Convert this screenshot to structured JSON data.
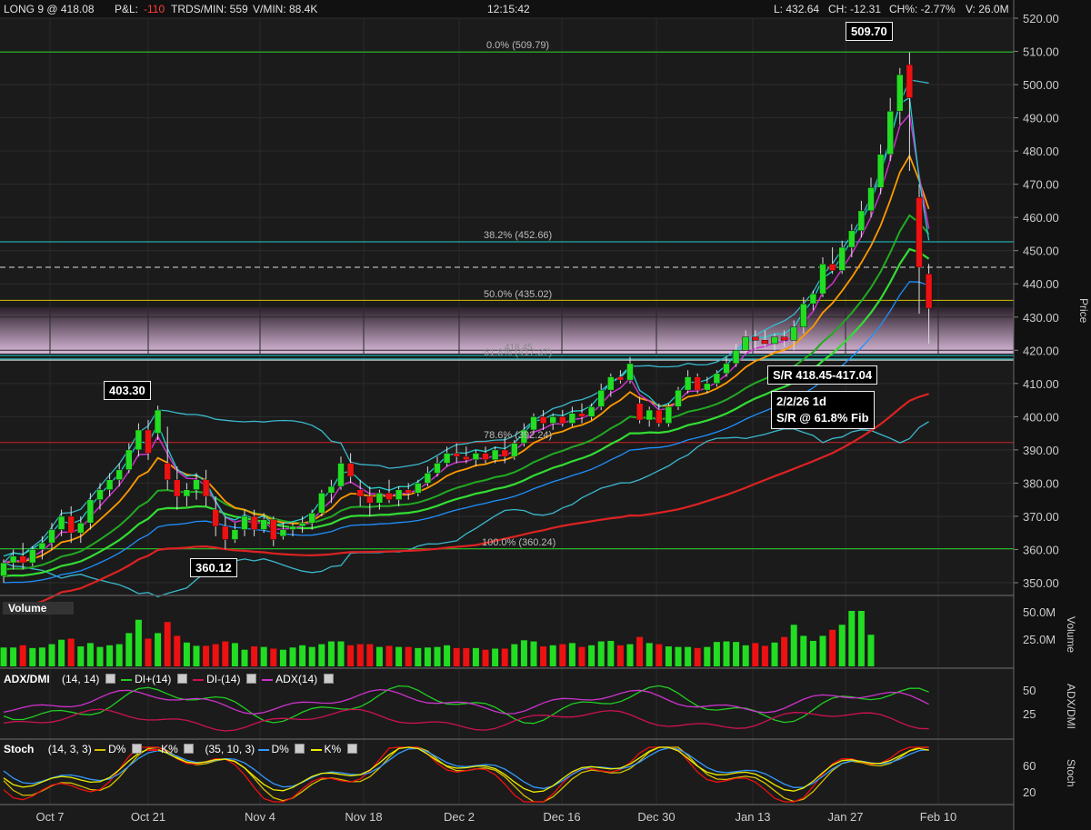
{
  "header": {
    "position": "LONG 9 @ 418.08",
    "pnl_label": "P&L:",
    "pnl_value": "-110",
    "trades_per_min": "TRDS/MIN: 559",
    "volume_per_min": "V/MIN: 88.4K",
    "clock": "12:15:42",
    "last": "L: 432.64",
    "change": "CH: -12.31",
    "change_pct": "CH%: -2.77%",
    "volume": "V: 26.0M"
  },
  "colors": {
    "up": "#22dd22",
    "down": "#ee1111",
    "background": "#1b1b1b",
    "fib_green": "#22cc22",
    "fib_cyan": "#22cccc",
    "fib_yellow": "#d4c000",
    "fib_red": "#cc2222"
  },
  "panels": {
    "volume_title": "Volume",
    "adx_title": "ADX/DMI",
    "adx_params": "(14, 14)",
    "adx_di_plus": "DI+(14)",
    "adx_di_minus": "DI-(14)",
    "adx_adx": "ADX(14)",
    "stoch_title": "Stoch",
    "stoch_params1": "(14, 3, 3)",
    "stoch_d1": "D%",
    "stoch_k1": "K%",
    "stoch_params2": "(35, 10, 3)",
    "stoch_d2": "D%",
    "stoch_k2": "K%"
  },
  "annotations": {
    "high_tag": "509.70",
    "peak_tag": "403.30",
    "low_tag": "360.12",
    "sr_tag": "S/R 418.45-417.04",
    "note_line1": "2/2/26 1d",
    "note_line2": "S/R @ 61.8% Fib",
    "fib_0": "0.0% (509.79)",
    "fib_382": "38.2% (452.66)",
    "fib_50": "50.0% (435.02)",
    "fib_618": "61.8% (417.37)",
    "fib_618_overlay": "418.45",
    "fib_786": "78.6% (392.24)",
    "fib_100": "100.0% (360.24)"
  },
  "chart_data": {
    "type": "candlestick",
    "ylabel": "Price",
    "ylim": [
      345,
      525
    ],
    "yticks": [
      "350.00",
      "360.00",
      "370.00",
      "380.00",
      "390.00",
      "400.00",
      "410.00",
      "420.00",
      "430.00",
      "440.00",
      "450.00",
      "460.00",
      "470.00",
      "480.00",
      "490.00",
      "500.00",
      "510.00",
      "520.00"
    ],
    "x_labels": [
      "Oct 7",
      "Oct 21",
      "Nov 4",
      "Nov 18",
      "Dec 2",
      "Dec 16",
      "Dec 30",
      "Jan 13",
      "Jan 27",
      "Feb 10"
    ],
    "fib_levels": [
      509.79,
      452.66,
      435.02,
      417.37,
      392.24,
      360.24
    ],
    "sr_zone": [
      417.04,
      418.45
    ],
    "current_price_line": 445,
    "candles": [
      {
        "o": 352,
        "h": 357,
        "l": 350,
        "c": 356
      },
      {
        "o": 356,
        "h": 360,
        "l": 354,
        "c": 358
      },
      {
        "o": 358,
        "h": 362,
        "l": 354,
        "c": 356
      },
      {
        "o": 356,
        "h": 361,
        "l": 355,
        "c": 360
      },
      {
        "o": 360,
        "h": 364,
        "l": 357,
        "c": 362
      },
      {
        "o": 362,
        "h": 368,
        "l": 360,
        "c": 366
      },
      {
        "o": 366,
        "h": 372,
        "l": 364,
        "c": 370
      },
      {
        "o": 370,
        "h": 373,
        "l": 362,
        "c": 365
      },
      {
        "o": 365,
        "h": 370,
        "l": 362,
        "c": 368
      },
      {
        "o": 368,
        "h": 377,
        "l": 366,
        "c": 375
      },
      {
        "o": 375,
        "h": 380,
        "l": 372,
        "c": 378
      },
      {
        "o": 378,
        "h": 383,
        "l": 376,
        "c": 381
      },
      {
        "o": 381,
        "h": 386,
        "l": 379,
        "c": 384
      },
      {
        "o": 384,
        "h": 392,
        "l": 383,
        "c": 390
      },
      {
        "o": 390,
        "h": 398,
        "l": 388,
        "c": 396
      },
      {
        "o": 396,
        "h": 399,
        "l": 387,
        "c": 389
      },
      {
        "o": 395,
        "h": 403.3,
        "l": 393,
        "c": 402
      },
      {
        "o": 386,
        "h": 397,
        "l": 378,
        "c": 381
      },
      {
        "o": 381,
        "h": 385,
        "l": 372,
        "c": 376
      },
      {
        "o": 376,
        "h": 380,
        "l": 373,
        "c": 378
      },
      {
        "o": 378,
        "h": 383,
        "l": 375,
        "c": 381
      },
      {
        "o": 381,
        "h": 384,
        "l": 373,
        "c": 376
      },
      {
        "o": 372,
        "h": 376,
        "l": 364,
        "c": 367
      },
      {
        "o": 367,
        "h": 370,
        "l": 360.12,
        "c": 363
      },
      {
        "o": 363,
        "h": 368,
        "l": 362,
        "c": 366
      },
      {
        "o": 366,
        "h": 372,
        "l": 364,
        "c": 370
      },
      {
        "o": 370,
        "h": 372,
        "l": 364,
        "c": 366
      },
      {
        "o": 366,
        "h": 371,
        "l": 365,
        "c": 369
      },
      {
        "o": 369,
        "h": 370,
        "l": 361,
        "c": 363
      },
      {
        "o": 364,
        "h": 368,
        "l": 363,
        "c": 366
      },
      {
        "o": 366,
        "h": 368,
        "l": 364,
        "c": 367
      },
      {
        "o": 367,
        "h": 370,
        "l": 365,
        "c": 368
      },
      {
        "o": 368,
        "h": 372,
        "l": 366,
        "c": 371
      },
      {
        "o": 371,
        "h": 378,
        "l": 370,
        "c": 377
      },
      {
        "o": 377,
        "h": 381,
        "l": 374,
        "c": 379
      },
      {
        "o": 379,
        "h": 388,
        "l": 378,
        "c": 386
      },
      {
        "o": 386,
        "h": 389,
        "l": 380,
        "c": 382
      },
      {
        "o": 378,
        "h": 381,
        "l": 373,
        "c": 376
      },
      {
        "o": 376,
        "h": 379,
        "l": 370,
        "c": 374
      },
      {
        "o": 374,
        "h": 378,
        "l": 372,
        "c": 377
      },
      {
        "o": 377,
        "h": 381,
        "l": 374,
        "c": 375
      },
      {
        "o": 375,
        "h": 379,
        "l": 373,
        "c": 378
      },
      {
        "o": 378,
        "h": 380,
        "l": 375,
        "c": 377
      },
      {
        "o": 377,
        "h": 381,
        "l": 376,
        "c": 380
      },
      {
        "o": 380,
        "h": 385,
        "l": 379,
        "c": 383
      },
      {
        "o": 383,
        "h": 388,
        "l": 382,
        "c": 386
      },
      {
        "o": 386,
        "h": 391,
        "l": 385,
        "c": 389
      },
      {
        "o": 389,
        "h": 392,
        "l": 386,
        "c": 388
      },
      {
        "o": 388,
        "h": 391,
        "l": 386,
        "c": 387
      },
      {
        "o": 387,
        "h": 390,
        "l": 385,
        "c": 389
      },
      {
        "o": 389,
        "h": 391,
        "l": 386,
        "c": 387
      },
      {
        "o": 387,
        "h": 391,
        "l": 386,
        "c": 390
      },
      {
        "o": 390,
        "h": 394,
        "l": 386,
        "c": 388
      },
      {
        "o": 388,
        "h": 393,
        "l": 387,
        "c": 392
      },
      {
        "o": 392,
        "h": 398,
        "l": 391,
        "c": 396
      },
      {
        "o": 396,
        "h": 401,
        "l": 395,
        "c": 400
      },
      {
        "o": 400,
        "h": 402,
        "l": 396,
        "c": 398
      },
      {
        "o": 398,
        "h": 401,
        "l": 396,
        "c": 400
      },
      {
        "o": 400,
        "h": 402,
        "l": 397,
        "c": 398
      },
      {
        "o": 398,
        "h": 403,
        "l": 397,
        "c": 401
      },
      {
        "o": 401,
        "h": 404,
        "l": 398,
        "c": 400
      },
      {
        "o": 400,
        "h": 404,
        "l": 399,
        "c": 403
      },
      {
        "o": 403,
        "h": 410,
        "l": 402,
        "c": 408
      },
      {
        "o": 408,
        "h": 413,
        "l": 406,
        "c": 412
      },
      {
        "o": 412,
        "h": 414,
        "l": 410,
        "c": 411
      },
      {
        "o": 411,
        "h": 418,
        "l": 410,
        "c": 416
      },
      {
        "o": 404,
        "h": 406,
        "l": 398,
        "c": 399
      },
      {
        "o": 399,
        "h": 403,
        "l": 397,
        "c": 402
      },
      {
        "o": 402,
        "h": 404,
        "l": 397,
        "c": 398
      },
      {
        "o": 398,
        "h": 404,
        "l": 397,
        "c": 403
      },
      {
        "o": 403,
        "h": 409,
        "l": 402,
        "c": 408
      },
      {
        "o": 408,
        "h": 414,
        "l": 407,
        "c": 412
      },
      {
        "o": 412,
        "h": 413,
        "l": 407,
        "c": 408
      },
      {
        "o": 408,
        "h": 412,
        "l": 407,
        "c": 410
      },
      {
        "o": 410,
        "h": 414,
        "l": 409,
        "c": 413
      },
      {
        "o": 413,
        "h": 418,
        "l": 412,
        "c": 416
      },
      {
        "o": 416,
        "h": 422,
        "l": 415,
        "c": 420
      },
      {
        "o": 420,
        "h": 426,
        "l": 419,
        "c": 424
      },
      {
        "o": 424,
        "h": 426,
        "l": 420,
        "c": 423
      },
      {
        "o": 423,
        "h": 426,
        "l": 421,
        "c": 422
      },
      {
        "o": 422,
        "h": 425,
        "l": 420,
        "c": 424
      },
      {
        "o": 424,
        "h": 426,
        "l": 421,
        "c": 423
      },
      {
        "o": 423,
        "h": 429,
        "l": 420,
        "c": 427
      },
      {
        "o": 427,
        "h": 436,
        "l": 425,
        "c": 434
      },
      {
        "o": 434,
        "h": 438,
        "l": 432,
        "c": 437
      },
      {
        "o": 437,
        "h": 448,
        "l": 436,
        "c": 446
      },
      {
        "o": 446,
        "h": 451,
        "l": 443,
        "c": 444
      },
      {
        "o": 444,
        "h": 453,
        "l": 443,
        "c": 451
      },
      {
        "o": 451,
        "h": 458,
        "l": 448,
        "c": 456
      },
      {
        "o": 456,
        "h": 465,
        "l": 454,
        "c": 462
      },
      {
        "o": 462,
        "h": 472,
        "l": 460,
        "c": 469
      },
      {
        "o": 469,
        "h": 482,
        "l": 467,
        "c": 479
      },
      {
        "o": 479,
        "h": 496,
        "l": 477,
        "c": 492
      },
      {
        "o": 492,
        "h": 505,
        "l": 488,
        "c": 503
      },
      {
        "o": 506,
        "h": 509.7,
        "l": 474,
        "c": 496
      },
      {
        "o": 466,
        "h": 470,
        "l": 431,
        "c": 445
      },
      {
        "o": 443,
        "h": 446,
        "l": 422,
        "c": 432.64
      }
    ],
    "volume": [
      0.34,
      0.34,
      0.38,
      0.33,
      0.34,
      0.4,
      0.48,
      0.5,
      0.36,
      0.42,
      0.35,
      0.38,
      0.4,
      0.6,
      0.84,
      0.5,
      0.6,
      0.8,
      0.55,
      0.43,
      0.37,
      0.37,
      0.4,
      0.45,
      0.42,
      0.3,
      0.36,
      0.35,
      0.32,
      0.3,
      0.34,
      0.38,
      0.35,
      0.4,
      0.45,
      0.45,
      0.38,
      0.4,
      0.4,
      0.35,
      0.37,
      0.35,
      0.35,
      0.33,
      0.34,
      0.35,
      0.38,
      0.33,
      0.33,
      0.33,
      0.3,
      0.32,
      0.32,
      0.4,
      0.47,
      0.45,
      0.36,
      0.38,
      0.4,
      0.42,
      0.35,
      0.38,
      0.45,
      0.46,
      0.38,
      0.4,
      0.53,
      0.42,
      0.4,
      0.36,
      0.35,
      0.35,
      0.33,
      0.35,
      0.44,
      0.45,
      0.44,
      0.38,
      0.42,
      0.37,
      0.43,
      0.53,
      0.75,
      0.55,
      0.46,
      0.55,
      0.66,
      0.75,
      1.0,
      1.0,
      0.57
    ],
    "adx": [],
    "stoch": []
  }
}
